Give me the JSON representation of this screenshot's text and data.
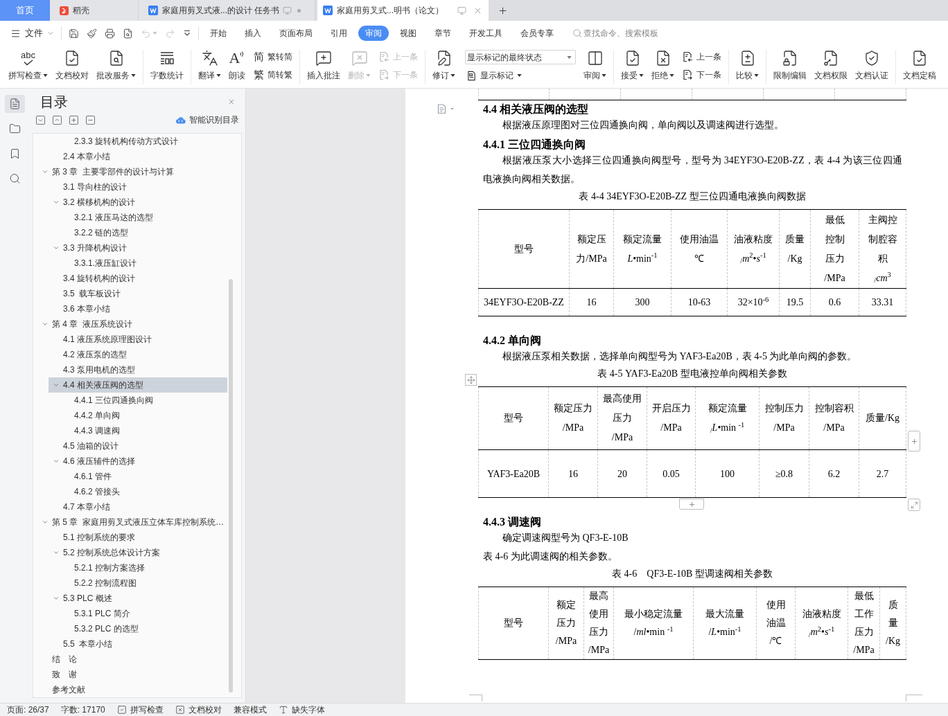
{
  "tabs": [
    {
      "label": "首页",
      "kind": "home",
      "selected": false
    },
    {
      "label": "稻壳",
      "kind": "docer",
      "selected": false
    },
    {
      "label": "家庭用剪叉式液...的设计 任务书",
      "kind": "document",
      "selected": false
    },
    {
      "label": "家庭用剪叉式...明书（论文）",
      "kind": "document",
      "selected": true
    }
  ],
  "menu": {
    "file": "文件",
    "quick_access": [
      {
        "disabled": false
      },
      {
        "disabled": false
      },
      {
        "disabled": false
      },
      {
        "disabled": false
      },
      {
        "disabled": true
      },
      {
        "disabled": true
      },
      {
        "disabled": false
      }
    ],
    "tabs": [
      {
        "label": "开始",
        "selected": false
      },
      {
        "label": "插入",
        "selected": false
      },
      {
        "label": "页面布局",
        "selected": false
      },
      {
        "label": "引用",
        "selected": false
      },
      {
        "label": "审阅",
        "selected": true
      },
      {
        "label": "视图",
        "selected": false
      },
      {
        "label": "章节",
        "selected": false
      },
      {
        "label": "开发工具",
        "selected": false
      },
      {
        "label": "会员专享",
        "selected": false
      }
    ],
    "search": {
      "placeholder": "查找命令、搜索模板"
    }
  },
  "ribbon": {
    "groups": [
      {
        "items": [
          {
            "kind": "big",
            "label": "拼写检查",
            "glyph": "abc",
            "dropdown": true,
            "disabled": false
          },
          {
            "kind": "big",
            "label": "文档校对",
            "dropdown": false,
            "disabled": false
          },
          {
            "kind": "big",
            "label": "批改服务",
            "dropdown": true,
            "disabled": false
          }
        ]
      },
      {
        "items": [
          {
            "kind": "big",
            "label": "字数统计",
            "dropdown": false,
            "disabled": false
          }
        ]
      },
      {
        "items": [
          {
            "kind": "big",
            "label": "翻译",
            "dropdown": true,
            "disabled": false
          },
          {
            "kind": "big",
            "label": "朗读",
            "glyph": "A",
            "dropdown": false,
            "disabled": false
          },
          {
            "kind": "pair",
            "rows": [
              {
                "label": "繁转简",
                "glyph": "简",
                "disabled": false
              },
              {
                "label": "简转繁",
                "glyph": "繁",
                "disabled": false
              }
            ]
          }
        ]
      },
      {
        "items": [
          {
            "kind": "big",
            "label": "插入批注",
            "dropdown": false,
            "disabled": false
          },
          {
            "kind": "big",
            "label": "删除",
            "dropdown": true,
            "disabled": true
          },
          {
            "kind": "pair",
            "rows": [
              {
                "label": "上一条",
                "disabled": true
              },
              {
                "label": "下一条",
                "disabled": true
              }
            ]
          }
        ]
      },
      {
        "items": [
          {
            "kind": "big",
            "label": "修订",
            "dropdown": true,
            "disabled": false
          },
          {
            "kind": "select",
            "value": "显示标记的最终状态",
            "button": {
              "label": "显示标记",
              "dropdown": true
            }
          },
          {
            "kind": "big",
            "label": "审阅",
            "dropdown": true,
            "disabled": false
          }
        ]
      },
      {
        "items": [
          {
            "kind": "big",
            "label": "接受",
            "dropdown": true,
            "disabled": false
          },
          {
            "kind": "big",
            "label": "拒绝",
            "dropdown": true,
            "disabled": false
          },
          {
            "kind": "pair",
            "rows": [
              {
                "label": "上一条",
                "disabled": false
              },
              {
                "label": "下一条",
                "disabled": false
              }
            ]
          }
        ]
      },
      {
        "items": [
          {
            "kind": "big",
            "label": "比较",
            "dropdown": true,
            "disabled": false
          }
        ]
      },
      {
        "items": [
          {
            "kind": "big",
            "label": "限制编辑",
            "dropdown": false,
            "disabled": false
          },
          {
            "kind": "big",
            "label": "文档权限",
            "dropdown": false,
            "disabled": false
          },
          {
            "kind": "big",
            "label": "文档认证",
            "dropdown": false,
            "disabled": false
          }
        ]
      },
      {
        "items": [
          {
            "kind": "big",
            "label": "文档定稿",
            "dropdown": false,
            "disabled": false
          }
        ]
      }
    ]
  },
  "side_rail": {
    "buttons": [
      {
        "selected": true
      },
      {
        "selected": false
      },
      {
        "selected": false
      },
      {
        "selected": false
      }
    ]
  },
  "toc_panel": {
    "title": "目录",
    "smart_toc": "智能识别目录",
    "tree": [
      {
        "children": [
          {
            "children": [
              {
                "label": "2.3.3 旋转机构传动方式设计",
                "selected": false
              }
            ]
          },
          {
            "label": "2.4 本章小结",
            "selected": false
          }
        ]
      },
      {
        "label": "第 3 章  主要零部件的设计与计算",
        "selected": false,
        "expanded": true,
        "children": [
          {
            "label": "3.1 导向柱的设计",
            "selected": false
          },
          {
            "label": "3.2 横移机构的设计",
            "selected": false,
            "expanded": true,
            "children": [
              {
                "label": "3.2.1 液压马达的选型",
                "selected": false
              },
              {
                "label": "3.2.2 链的选型",
                "selected": false
              }
            ]
          },
          {
            "label": "3.3 升降机构设计",
            "selected": false,
            "expanded": true,
            "children": [
              {
                "label": "3.3.1.液压缸设计",
                "selected": false
              }
            ]
          },
          {
            "label": "3.4 旋转机构的设计",
            "selected": false
          },
          {
            "label": "3.5  载车板设计",
            "selected": false
          },
          {
            "label": "3.6 本章小结",
            "selected": false
          }
        ]
      },
      {
        "label": "第 4 章  液压系统设计",
        "selected": false,
        "expanded": true,
        "children": [
          {
            "label": "4.1 液压系统原理图设计",
            "selected": false
          },
          {
            "label": "4.2 液压泵的选型",
            "selected": false
          },
          {
            "label": "4.3 泵用电机的选型",
            "selected": false
          },
          {
            "label": "4.4 相关液压阀的选型",
            "selected": true,
            "expanded": true,
            "children": [
              {
                "label": "4.4.1 三位四通换向阀",
                "selected": false
              },
              {
                "label": "4.4.2 单向阀",
                "selected": false
              },
              {
                "label": "4.4.3 调速阀",
                "selected": false
              }
            ]
          },
          {
            "label": "4.5 油箱的设计",
            "selected": false
          },
          {
            "label": "4.6 液压辅件的选择",
            "selected": false,
            "expanded": true,
            "children": [
              {
                "label": "4.6.1 管件",
                "selected": false
              },
              {
                "label": "4.6.2 管接头",
                "selected": false
              }
            ]
          },
          {
            "label": "4.7 本章小结",
            "selected": false
          }
        ]
      },
      {
        "label": "第 5 章  家庭用剪叉式液压立体车库控制系统…",
        "selected": false,
        "expanded": true,
        "children": [
          {
            "label": "5.1 控制系统的要求",
            "selected": false
          },
          {
            "label": "5.2 控制系统总体设计方案",
            "selected": false,
            "expanded": true,
            "children": [
              {
                "label": "5.2.1 控制方案选择",
                "selected": false
              },
              {
                "label": "5.2.2 控制流程图",
                "selected": false
              }
            ]
          },
          {
            "label": "5.3 PLC 概述",
            "selected": false,
            "expanded": true,
            "children": [
              {
                "label": "5.3.1 PLC 简介",
                "selected": false
              },
              {
                "label": "5.3.2 PLC 的选型",
                "selected": false
              }
            ]
          },
          {
            "label": "5.5  本章小结",
            "selected": false
          }
        ]
      },
      {
        "label": "结　论",
        "selected": false
      },
      {
        "label": "致　谢",
        "selected": false
      },
      {
        "label": "参考文献",
        "selected": false
      }
    ]
  },
  "document": {
    "blocks": [
      {
        "kind": "table_tail"
      },
      {
        "kind": "heading",
        "text": "4.4 相关液压阀的选型"
      },
      {
        "kind": "paragraph",
        "indent": true,
        "text": "根据液压原理图对三位四通换向阀，单向阀以及调速阀进行选型。"
      },
      {
        "kind": "heading",
        "text": "4.4.1 三位四通换向阀"
      },
      {
        "kind": "paragraph",
        "indent": true,
        "text": "根据液压泵大小选择三位四通换向阀型号，型号为 34EYF3O-E20B-ZZ，表 4-4 为该三位四通电液换向阀相关数据。"
      },
      {
        "kind": "caption",
        "text": "表 4-4 34EYF3O-E20B-ZZ 型三位四通电液换向阀数据"
      },
      {
        "kind": "table",
        "columns": [
          "型号",
          "额定压力/MPa",
          "额定流量\n*L*•min$^{-1}$",
          "使用油温\n℃",
          "油液粘度\n$_{/}$*m*$^{2}$•*s*$^{-1}$",
          "质量\n/Kg",
          "最低控制压力\n/MPa",
          "主阀控制腔容积\n$_{/}$*cm*$^{3}$"
        ],
        "rows": [
          [
            "34EYF3O-E20B-ZZ",
            "16",
            "300",
            "10-63",
            "32×10$^{-6}$",
            "19.5",
            "0.6",
            "33.31"
          ]
        ]
      },
      {
        "kind": "heading",
        "text": "4.4.2 单向阀"
      },
      {
        "kind": "paragraph",
        "indent": true,
        "text": "根据液压泵相关数据，选择单向阀型号为 YAF3-Ea20B，表 4-5 为此单向阀的参数。"
      },
      {
        "kind": "caption",
        "text": "表 4-5 YAF3-Ea20B 型电液控单向阀相关参数"
      },
      {
        "kind": "table",
        "columns": [
          "型号",
          "额定压力\n/MPa",
          "最高使用压力\n/MPa",
          "开启压力\n/MPa",
          "额定流量\n$_{/}$*L*•min $^{-1}$",
          "控制压力\n/MPa",
          "控制容积\n/MPa",
          "质量/Kg"
        ],
        "rows": [
          [
            "YAF3-Ea20B",
            "16",
            "20",
            "0.05",
            "100",
            "≥0.8",
            "6.2",
            "2.7"
          ]
        ],
        "handles": [
          {
            "kind": "move"
          },
          {
            "kind": "add_column"
          },
          {
            "kind": "add_row"
          },
          {
            "kind": "resize"
          }
        ]
      },
      {
        "kind": "heading",
        "text": "4.4.3 调速阀"
      },
      {
        "kind": "paragraph",
        "indent": true,
        "text": "确定调速阀型号为 QF3-E-10B"
      },
      {
        "kind": "paragraph",
        "indent": false,
        "text": "表 4-6 为此调速阀的相关参数。"
      },
      {
        "kind": "caption",
        "text": "表 4-6　QF3-E-10B 型调速阀相关参数"
      },
      {
        "kind": "table",
        "columns": [
          "型号",
          "额定压力\n/MPa",
          "最高使用压力\n/MPa",
          "最小稳定流量\n/*ml*•min $^{-1}$",
          "最大流量\n/*L*•min$^{-1}$",
          "使用油温\n/℃",
          "油液粘度\n$_{/}$*m*$^{2}$•*s*$^{-1}$",
          "最低工作压力\n/MPa",
          "质量\n/Kg"
        ]
      }
    ]
  },
  "status_bar": [
    {
      "kind": "text",
      "label": "页面: 26/37"
    },
    {
      "kind": "text",
      "label": "字数: 17170"
    },
    {
      "kind": "icon",
      "label": "拼写检查"
    },
    {
      "kind": "icon",
      "label": "文档校对"
    },
    {
      "kind": "text",
      "label": "兼容模式"
    },
    {
      "kind": "icon",
      "label": "缺失字体"
    }
  ]
}
